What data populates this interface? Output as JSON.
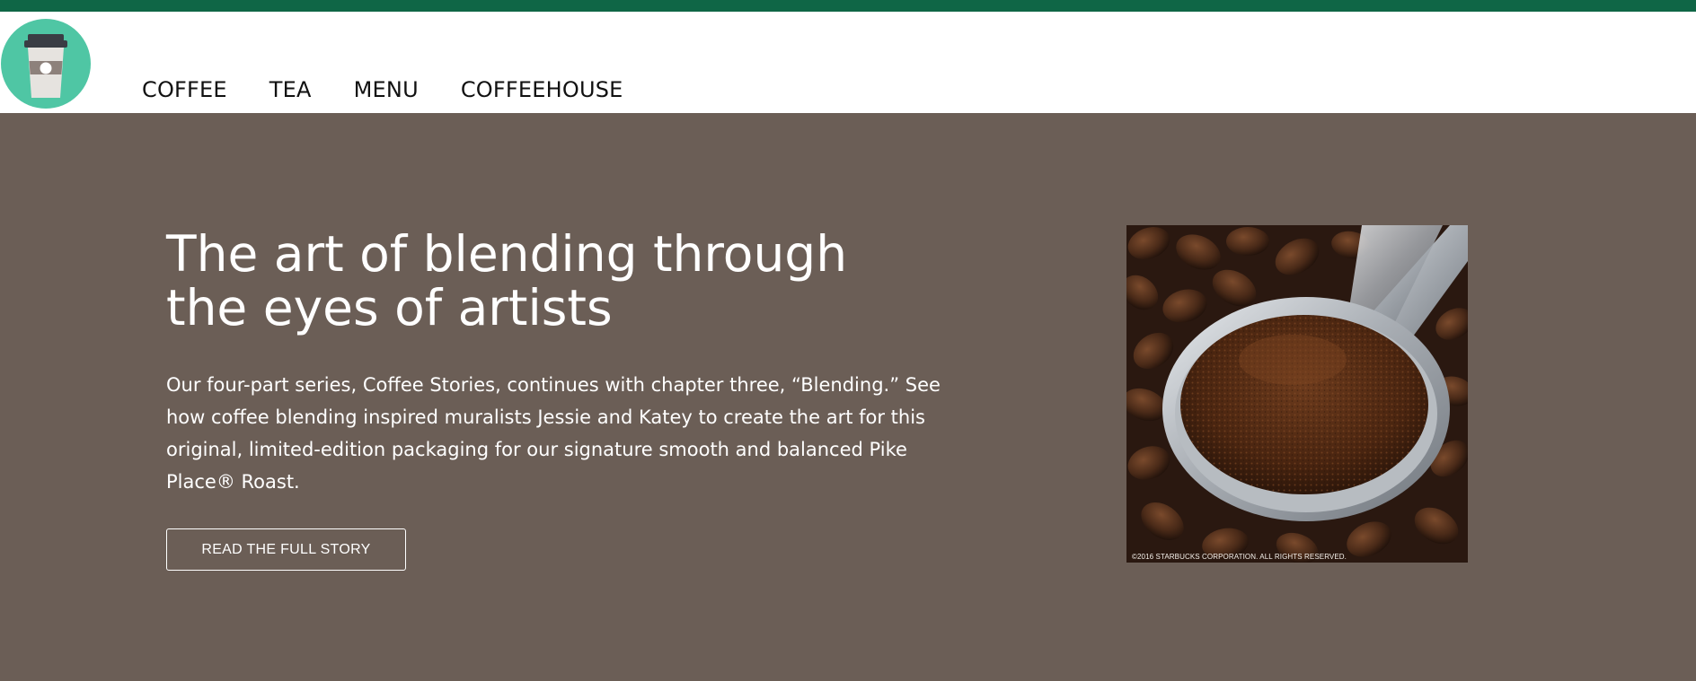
{
  "header": {
    "logo_icon": "coffee-cup-icon",
    "accent_color": "#0f6646",
    "nav": [
      {
        "label": "COFFEE"
      },
      {
        "label": "TEA"
      },
      {
        "label": "MENU"
      },
      {
        "label": "COFFEEHOUSE"
      }
    ]
  },
  "hero": {
    "background_color": "#6b5e56",
    "title": "The art of blending through the eyes of artists",
    "body": "Our four-part series, Coffee Stories, continues with chapter three, “Blending.” See how coffee blending inspired muralists Jessie and Katey to create the art for this original, limited-edition packaging for our signature smooth and balanced Pike Place® Roast.",
    "cta_label": "READ THE FULL STORY",
    "image": {
      "subject": "coffee-scoop-image",
      "copyright": "©2016 STARBUCKS CORPORATION. ALL RIGHTS RESERVED."
    }
  }
}
